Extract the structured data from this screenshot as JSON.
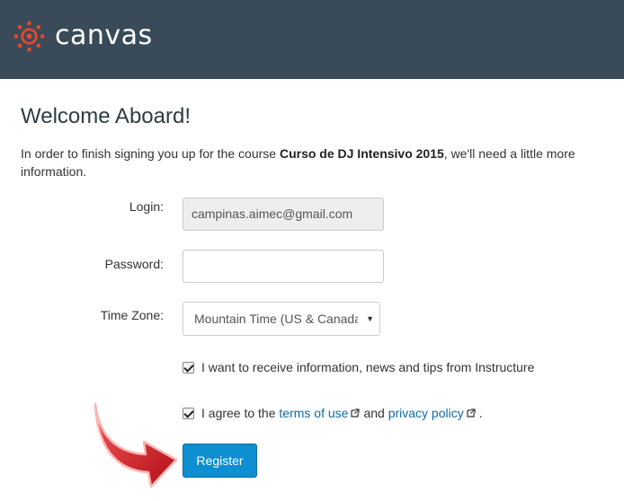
{
  "brand": {
    "name": "canvas",
    "logo_icon": "canvas-logo-icon",
    "header_color": "#394b58",
    "logo_color": "#e0492f"
  },
  "page": {
    "title": "Welcome Aboard!",
    "intro_before": "In order to finish signing you up for the course ",
    "course_name": "Curso de DJ Intensivo 2015",
    "intro_after": ", we'll need a little more information."
  },
  "form": {
    "login_label": "Login:",
    "login_value": "campinas.aimec@gmail.com",
    "password_label": "Password:",
    "password_value": "",
    "timezone_label": "Time Zone:",
    "timezone_value": "Mountain Time (US & Canada)",
    "newsletter_label": "I want to receive information, news and tips from Instructure",
    "newsletter_checked": true,
    "terms_prefix": "I agree to the ",
    "terms_link": "terms of use",
    "terms_and": " and ",
    "privacy_link": "privacy policy",
    "terms_suffix": ".",
    "terms_checked": true,
    "register_label": "Register",
    "button_color": "#0e8fd1"
  },
  "annotation": {
    "arrow_icon": "red-arrow-icon",
    "color": "#d0121b"
  }
}
